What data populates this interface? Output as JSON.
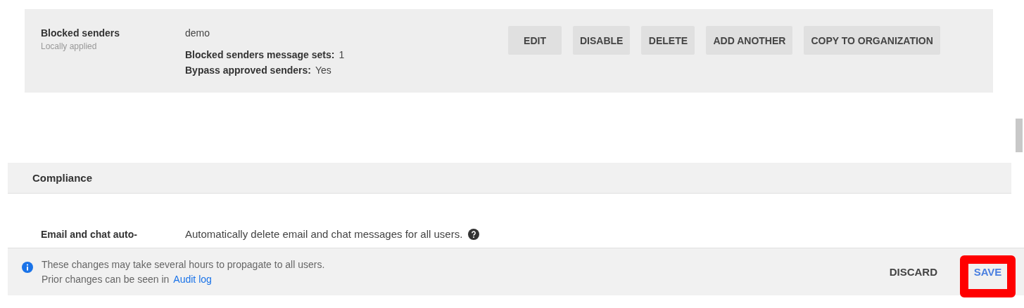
{
  "rule_card": {
    "title": "Blocked senders",
    "subtitle": "Locally applied",
    "name": "demo",
    "details": [
      {
        "label": "Blocked senders message sets:",
        "value": "1"
      },
      {
        "label": "Bypass approved senders:",
        "value": "Yes"
      }
    ],
    "buttons": [
      "EDIT",
      "DISABLE",
      "DELETE",
      "ADD ANOTHER",
      "COPY TO ORGANIZATION"
    ]
  },
  "section": {
    "title": "Compliance"
  },
  "setting": {
    "label": "Email and chat auto-",
    "description": "Automatically delete email and chat messages for all users."
  },
  "footer": {
    "message": "These changes may take several hours to propagate to all users.",
    "audit_prefix": "Prior changes can be seen in",
    "audit_link": "Audit log",
    "discard": "DISCARD",
    "save": "SAVE",
    "save_highlighted": true
  }
}
